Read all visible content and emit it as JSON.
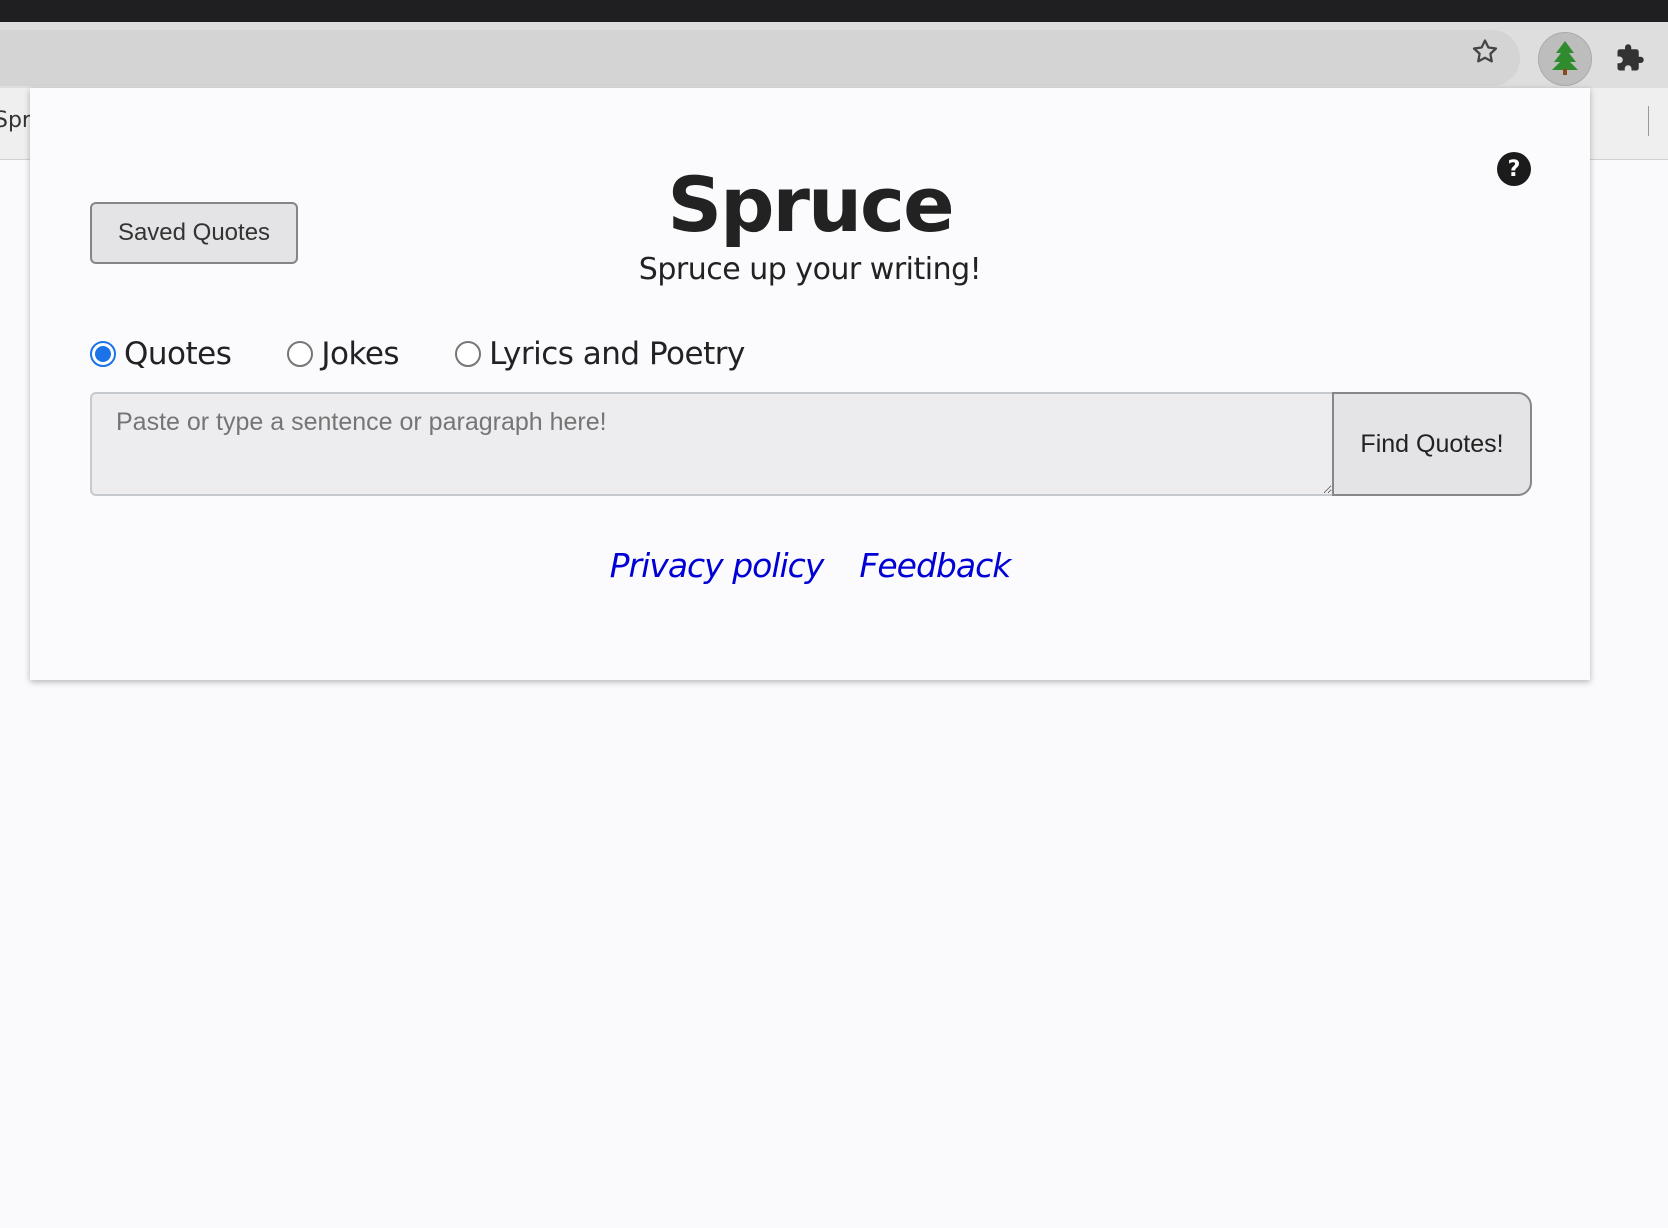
{
  "browser": {
    "background_tab_partial_title": "Spr",
    "icons": {
      "bookmark": "star-icon",
      "extension": "spruce-tree-icon",
      "extensions_menu": "puzzle-icon"
    }
  },
  "popup": {
    "help_label": "?",
    "saved_quotes_label": "Saved Quotes",
    "title": "Spruce",
    "tagline": "Spruce up your writing!",
    "modes": [
      {
        "label": "Quotes",
        "checked": true
      },
      {
        "label": "Jokes",
        "checked": false
      },
      {
        "label": "Lyrics and Poetry",
        "checked": false
      }
    ],
    "input": {
      "placeholder": "Paste or type a sentence or paragraph here!",
      "value": ""
    },
    "find_button_label": "Find Quotes!",
    "links": {
      "privacy": "Privacy policy",
      "feedback": "Feedback"
    }
  },
  "colors": {
    "accent": "#1a73e8",
    "link": "#0000d6",
    "text": "#222222"
  }
}
